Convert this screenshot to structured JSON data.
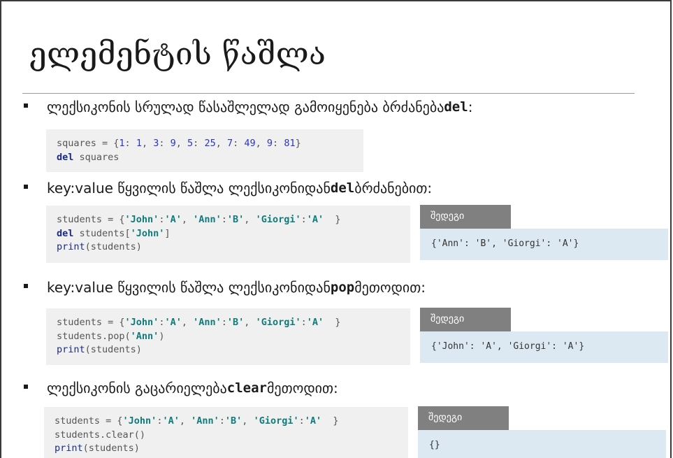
{
  "slide": {
    "title": "ელემენტის წაშლა"
  },
  "bullets": [
    {
      "before": "ლექსიკონის სრულად წასაშლელად გამოიყენება ბრძანება ",
      "keyword": "del",
      "after": ":"
    },
    {
      "before": "key:value წყვილის წაშლა ლექსიკონიდან ",
      "keyword": "del",
      "after": " ბრძანებით:"
    },
    {
      "before": "key:value წყვილის წაშლა ლექსიკონიდან ",
      "keyword": "pop",
      "after": " მეთოდით:"
    },
    {
      "before": "ლექსიკონის გაცარიელება  ",
      "keyword": "clear",
      "after": " მეთოდით:"
    }
  ],
  "code_blocks": [
    {
      "lines": [
        [
          [
            "plain",
            "squares = {"
          ],
          [
            "num",
            "1"
          ],
          [
            "plain",
            ": "
          ],
          [
            "num",
            "1"
          ],
          [
            "plain",
            ", "
          ],
          [
            "num",
            "3"
          ],
          [
            "plain",
            ": "
          ],
          [
            "num",
            "9"
          ],
          [
            "plain",
            ", "
          ],
          [
            "num",
            "5"
          ],
          [
            "plain",
            ": "
          ],
          [
            "num",
            "25"
          ],
          [
            "plain",
            ", "
          ],
          [
            "num",
            "7"
          ],
          [
            "plain",
            ": "
          ],
          [
            "num",
            "49"
          ],
          [
            "plain",
            ", "
          ],
          [
            "num",
            "9"
          ],
          [
            "plain",
            ": "
          ],
          [
            "num",
            "81"
          ],
          [
            "plain",
            "}"
          ]
        ],
        [
          [
            "kwd",
            "del"
          ],
          [
            "plain",
            " squares"
          ]
        ]
      ]
    },
    {
      "lines": [
        [
          [
            "plain",
            "students = {"
          ],
          [
            "str",
            "'John'"
          ],
          [
            "plain",
            ":"
          ],
          [
            "str",
            "'A'"
          ],
          [
            "plain",
            ", "
          ],
          [
            "str",
            "'Ann'"
          ],
          [
            "plain",
            ":"
          ],
          [
            "str",
            "'B'"
          ],
          [
            "plain",
            ", "
          ],
          [
            "str",
            "'Giorgi'"
          ],
          [
            "plain",
            ":"
          ],
          [
            "str",
            "'A'"
          ],
          [
            "plain",
            "  }"
          ]
        ],
        [
          [
            "kwd",
            "del"
          ],
          [
            "plain",
            " students["
          ],
          [
            "str",
            "'John'"
          ],
          [
            "plain",
            "]"
          ]
        ],
        [
          [
            "fn",
            "print"
          ],
          [
            "plain",
            "(students)"
          ]
        ]
      ]
    },
    {
      "lines": [
        [
          [
            "plain",
            "students = {"
          ],
          [
            "str",
            "'John'"
          ],
          [
            "plain",
            ":"
          ],
          [
            "str",
            "'A'"
          ],
          [
            "plain",
            ", "
          ],
          [
            "str",
            "'Ann'"
          ],
          [
            "plain",
            ":"
          ],
          [
            "str",
            "'B'"
          ],
          [
            "plain",
            ", "
          ],
          [
            "str",
            "'Giorgi'"
          ],
          [
            "plain",
            ":"
          ],
          [
            "str",
            "'A'"
          ],
          [
            "plain",
            "  }"
          ]
        ],
        [
          [
            "plain",
            "students.pop("
          ],
          [
            "str",
            "'Ann'"
          ],
          [
            "plain",
            ")"
          ]
        ],
        [
          [
            "fn",
            "print"
          ],
          [
            "plain",
            "(students)"
          ]
        ]
      ]
    },
    {
      "lines": [
        [
          [
            "plain",
            "students = {"
          ],
          [
            "str",
            "'John'"
          ],
          [
            "plain",
            ":"
          ],
          [
            "str",
            "'A'"
          ],
          [
            "plain",
            ", "
          ],
          [
            "str",
            "'Ann'"
          ],
          [
            "plain",
            ":"
          ],
          [
            "str",
            "'B'"
          ],
          [
            "plain",
            ", "
          ],
          [
            "str",
            "'Giorgi'"
          ],
          [
            "plain",
            ":"
          ],
          [
            "str",
            "'A'"
          ],
          [
            "plain",
            "  }"
          ]
        ],
        [
          [
            "plain",
            "students.clear()"
          ]
        ],
        [
          [
            "fn",
            "print"
          ],
          [
            "plain",
            "(students)"
          ]
        ]
      ]
    }
  ],
  "results": [
    {
      "label": "შედეგი",
      "output": "{'Ann': 'B', 'Giorgi': 'A'}"
    },
    {
      "label": "შედეგი",
      "output": "{'John': 'A', 'Giorgi': 'A'}"
    },
    {
      "label": "შედეგი",
      "output": "{}"
    }
  ],
  "colors": {
    "code_bg": "#f0f0f0",
    "result_label_bg": "#808080",
    "result_box_bg": "#dde9f2",
    "number": "#2a35c7",
    "string": "#107b7b",
    "keyword": "#1a2b86"
  }
}
